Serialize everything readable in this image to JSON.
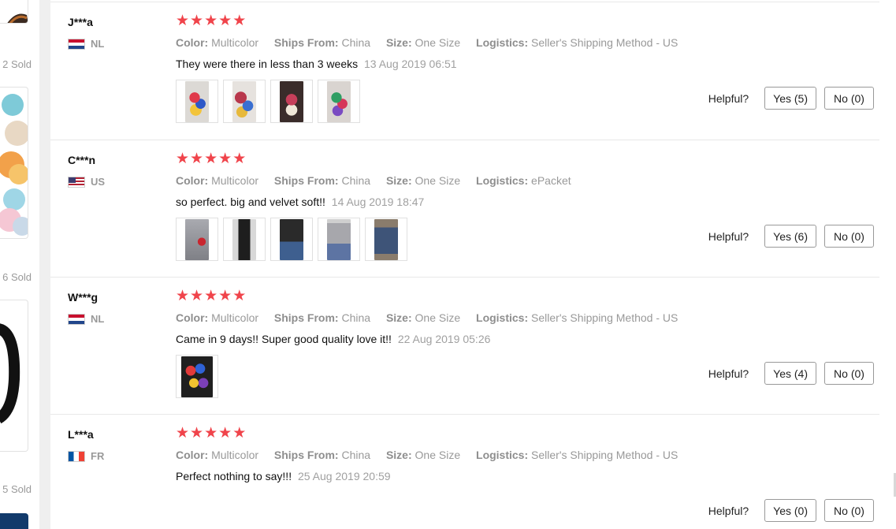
{
  "sidebar": {
    "sold_labels": [
      "2 Sold",
      "6 Sold",
      "5 Sold"
    ]
  },
  "colors": {
    "star": "#f0444b",
    "text_muted": "#999999",
    "button_border": "#999999"
  },
  "helpful_label": "Helpful?",
  "attr_keys": {
    "color": "Color:",
    "ships_from": "Ships From:",
    "size": "Size:",
    "logistics": "Logistics:"
  },
  "reviews": [
    {
      "name": "J***a",
      "country": "NL",
      "stars": 5,
      "color": "Multicolor",
      "ships_from": "China",
      "size": "One Size",
      "logistics": "Seller's Shipping Method - US",
      "text": "They were there in less than 3 weeks",
      "date": "13 Aug 2019 06:51",
      "photos": 4,
      "yes": "Yes (5)",
      "no": "No (0)"
    },
    {
      "name": "C***n",
      "country": "US",
      "stars": 5,
      "color": "Multicolor",
      "ships_from": "China",
      "size": "One Size",
      "logistics": "ePacket",
      "text": "so perfect. big and velvet soft!!",
      "date": "14 Aug 2019 18:47",
      "photos": 5,
      "yes": "Yes (6)",
      "no": "No (0)"
    },
    {
      "name": "W***g",
      "country": "NL",
      "stars": 5,
      "color": "Multicolor",
      "ships_from": "China",
      "size": "One Size",
      "logistics": "Seller's Shipping Method - US",
      "text": "Came in 9 days!! Super good quality love it!!",
      "date": "22 Aug 2019 05:26",
      "photos": 1,
      "yes": "Yes (4)",
      "no": "No (0)"
    },
    {
      "name": "L***a",
      "country": "FR",
      "stars": 5,
      "color": "Multicolor",
      "ships_from": "China",
      "size": "One Size",
      "logistics": "Seller's Shipping Method - US",
      "text": "Perfect nothing to say!!!",
      "date": "25 Aug 2019 20:59",
      "photos": 0,
      "yes": "Yes (0)",
      "no": "No (0)"
    }
  ]
}
